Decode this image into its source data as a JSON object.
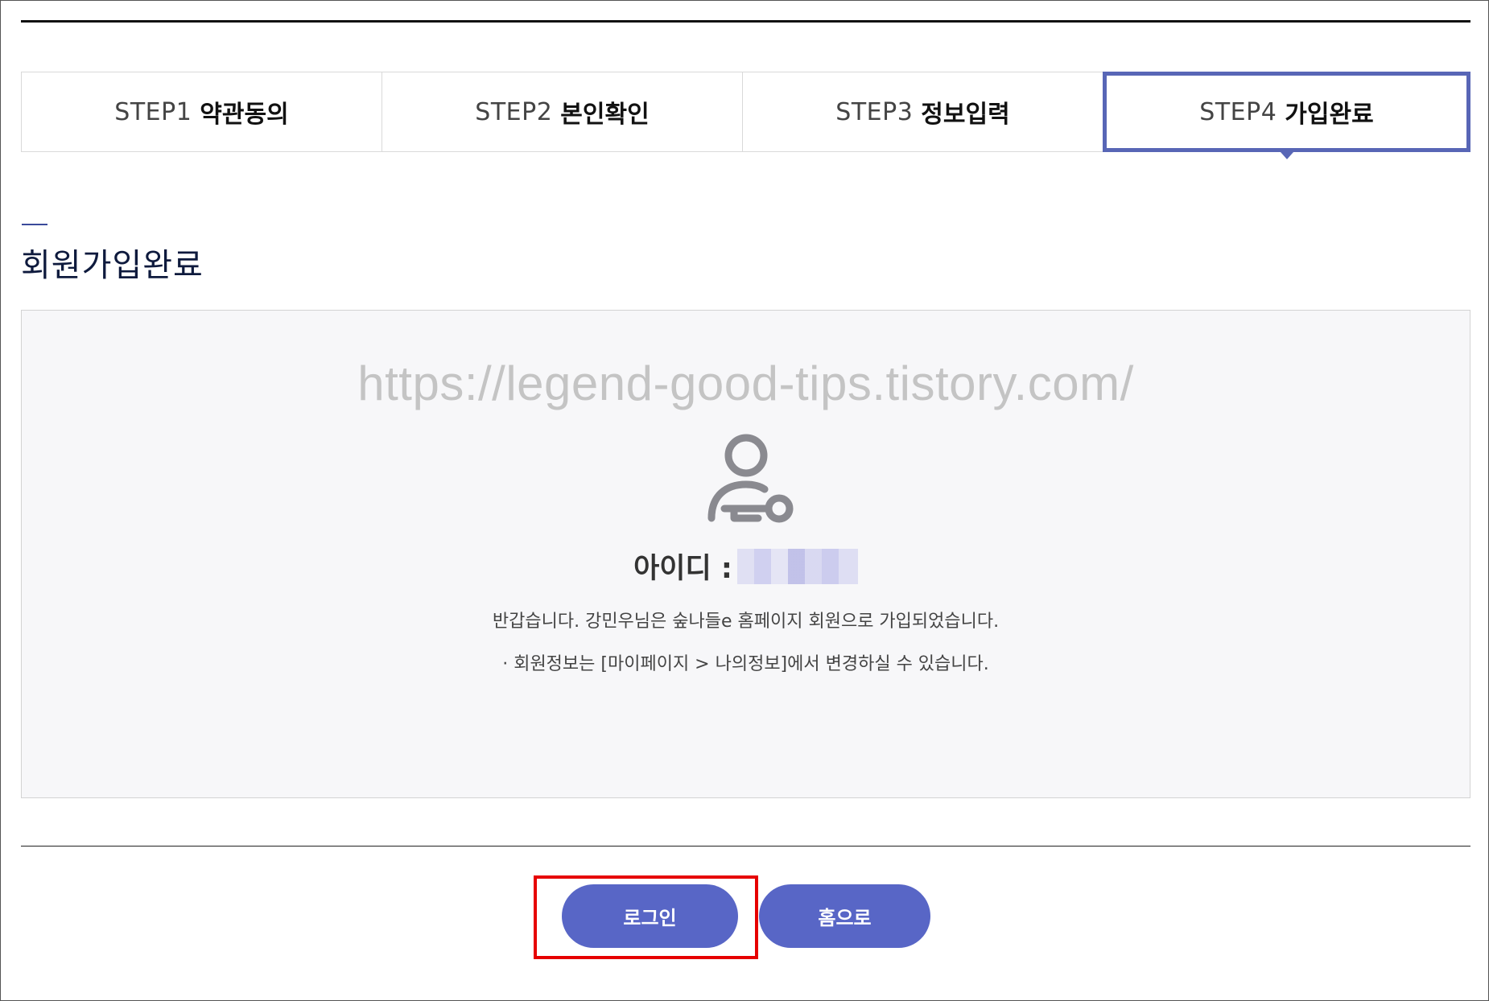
{
  "steps": [
    {
      "label": "STEP1",
      "name": "약관동의",
      "active": false
    },
    {
      "label": "STEP2",
      "name": "본인확인",
      "active": false
    },
    {
      "label": "STEP3",
      "name": "정보입력",
      "active": false
    },
    {
      "label": "STEP4",
      "name": "가입완료",
      "active": true
    }
  ],
  "page_title": "회원가입완료",
  "watermark": "https://legend-good-tips.tistory.com/",
  "result": {
    "icon": "user-key-icon",
    "id_label": "아이디 :",
    "welcome": "반갑습니다. 강민우님은 숲나들e 홈페이지 회원으로 가입되었습니다.",
    "info": "· 회원정보는 [마이페이지 > 나의정보]에서 변경하실 수 있습니다."
  },
  "buttons": {
    "login": "로그인",
    "home": "홈으로"
  },
  "colors": {
    "accent": "#5866c6",
    "active_step_border": "#5866b6",
    "highlight": "#e60000",
    "panel_bg": "#f7f7f9"
  }
}
